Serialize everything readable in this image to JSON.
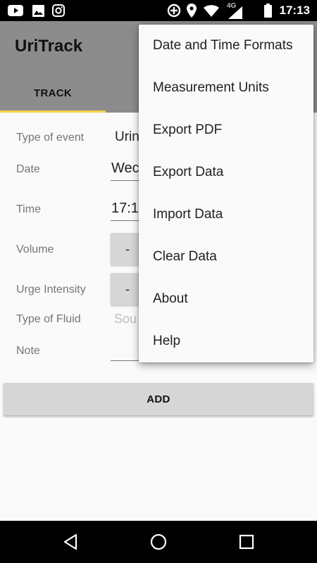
{
  "status_bar": {
    "time": "17:13",
    "network": "4G",
    "icons": [
      "youtube-icon",
      "photo-icon",
      "instagram-icon",
      "sync-icon",
      "location-icon",
      "wifi-icon",
      "cellular-icon",
      "battery-icon"
    ]
  },
  "app": {
    "title": "UriTrack",
    "tabs": [
      {
        "label": "TRACK",
        "selected": true
      }
    ],
    "accent_color": "#f6d24a",
    "toolbar_color": "#8c8c8c"
  },
  "form": {
    "type_of_event_label": "Type of event",
    "type_of_event_value": "Urin",
    "date_label": "Date",
    "date_value": "Wec",
    "time_label": "Time",
    "time_value": "17:1",
    "volume_label": "Volume",
    "volume_button": "-",
    "urge_intensity_label": "Urge Intensity",
    "urge_intensity_button": "-",
    "type_of_fluid_label": "Type of Fluid",
    "type_of_fluid_placeholder": "Sou",
    "note_label": "Note",
    "add_button": "ADD"
  },
  "menu": {
    "items": [
      "Date and Time Formats",
      "Measurement Units",
      "Export PDF",
      "Export Data",
      "Import Data",
      "Clear Data",
      "About",
      "Help"
    ]
  },
  "nav_bar": {
    "buttons": [
      "back-icon",
      "home-icon",
      "recents-icon"
    ]
  }
}
